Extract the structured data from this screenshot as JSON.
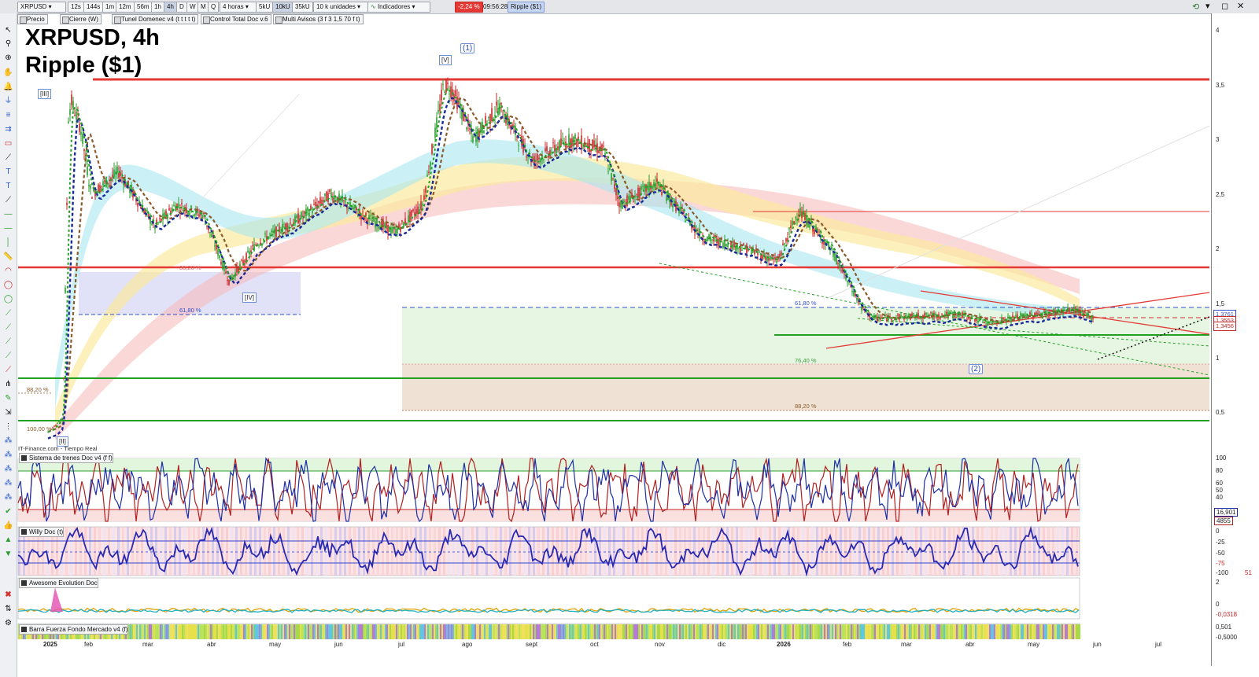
{
  "toolbar": {
    "symbol": "XRPUSD",
    "periods": [
      "12s",
      "144s",
      "1m",
      "12m",
      "56m",
      "1h",
      "4h",
      "D",
      "W",
      "M",
      "Q"
    ],
    "timeframe": "4 horas",
    "tick_modes": [
      "5kU",
      "10kU",
      "35kU"
    ],
    "units": "10 k unidades",
    "indicators": "Indicadores",
    "change": "-2,24 %",
    "time": "09:56:28",
    "name": "Ripple ($1)"
  },
  "indicator_bar": [
    "Precio",
    "Cierre (W)",
    "Tunel Domenec v4 (t t t t t)",
    "Control Total Doc v.6",
    "Multi Avisos (3 f 3 1,5 70 f t)"
  ],
  "chart": {
    "title_line1": "XRPUSD, 4h",
    "title_line2": "Ripple ($1)",
    "source": "IT-Finance.com - Tiempo Real",
    "wave_labels": [
      "[III]",
      "[II]",
      "[V]",
      "(1)",
      "[IV]",
      "(2)"
    ],
    "fib_labels": {
      "f1": "38,20 %",
      "f2": "61,80 %",
      "f3": "88,20 %",
      "f4": "100,00 %",
      "f5": "61,80 %",
      "f6": "76,40 %",
      "f7": "88,20 %"
    },
    "last_price": "1,3456",
    "price_tag_2": "1,3761",
    "price_tag_3": "1,3553",
    "colors": {
      "up": "#2e9d2e",
      "down": "#c62828",
      "red_line": "#e53935",
      "green_line": "#22a022",
      "blue_dash": "#3050d0"
    }
  },
  "axis": {
    "price_ticks": [
      "4",
      "3,5",
      "3",
      "2,5",
      "2",
      "1,5",
      "1",
      "0,5"
    ],
    "time_ticks": [
      "2025",
      "feb",
      "mar",
      "abr",
      "may",
      "jun",
      "jul",
      "ago",
      "sept",
      "oct",
      "nov",
      "dic",
      "2026",
      "feb",
      "mar",
      "abr",
      "may",
      "jun",
      "jul"
    ]
  },
  "panels": {
    "p1": {
      "title": "Sistema de trenes Doc v4 (f f)",
      "ticks": [
        "100",
        "80",
        "60",
        "50",
        "40"
      ],
      "v1": "16,901",
      "v2": "4855"
    },
    "p2": {
      "title": "Willy Doc (t)",
      "ticks": [
        "0",
        "-25",
        "-50",
        "-75",
        "-100"
      ],
      "v1": "51"
    },
    "p3": {
      "title": "Awesome Evolution Doc",
      "ticks": [
        "2",
        "0",
        "-0,0318"
      ]
    },
    "p4": {
      "title": "Barra Fuerza Fondo Mercado v4 (f)",
      "ticks": [
        "0,501",
        "-0,5000"
      ]
    }
  },
  "chart_data": {
    "type": "candlestick",
    "title": "XRPUSD, 4h",
    "price_axis": [
      0.5,
      4.0
    ],
    "x_labels": [
      "2025",
      "feb",
      "mar",
      "abr",
      "may",
      "jun",
      "jul",
      "ago",
      "sept",
      "oct",
      "nov",
      "dic",
      "2026",
      "feb",
      "mar",
      "abr",
      "may",
      "jun",
      "jul"
    ],
    "path": [
      [
        "2025-01-01",
        0.32
      ],
      [
        "2025-01-12",
        0.45
      ],
      [
        "2025-01-16",
        3.2
      ],
      [
        "2025-01-18",
        3.35
      ],
      [
        "2025-01-25",
        3.1
      ],
      [
        "2025-02-02",
        2.5
      ],
      [
        "2025-02-15",
        2.7
      ],
      [
        "2025-03-02",
        2.2
      ],
      [
        "2025-03-12",
        2.4
      ],
      [
        "2025-03-25",
        2.3
      ],
      [
        "2025-04-07",
        1.7
      ],
      [
        "2025-04-20",
        2.05
      ],
      [
        "2025-05-12",
        2.3
      ],
      [
        "2025-05-25",
        2.5
      ],
      [
        "2025-06-10",
        2.3
      ],
      [
        "2025-06-25",
        2.15
      ],
      [
        "2025-07-08",
        2.4
      ],
      [
        "2025-07-18",
        3.5
      ],
      [
        "2025-07-22",
        3.45
      ],
      [
        "2025-08-02",
        3.0
      ],
      [
        "2025-08-14",
        3.3
      ],
      [
        "2025-08-30",
        2.8
      ],
      [
        "2025-09-18",
        3.0
      ],
      [
        "2025-10-03",
        2.9
      ],
      [
        "2025-10-11",
        2.4
      ],
      [
        "2025-10-28",
        2.6
      ],
      [
        "2025-11-20",
        2.1
      ],
      [
        "2025-12-10",
        2.0
      ],
      [
        "2025-12-25",
        1.88
      ],
      [
        "2026-01-05",
        2.35
      ],
      [
        "2026-01-20",
        2.0
      ],
      [
        "2026-02-05",
        1.45
      ],
      [
        "2026-02-10",
        1.36
      ],
      [
        "2026-03-01",
        1.38
      ],
      [
        "2026-03-20",
        1.4
      ],
      [
        "2026-04-05",
        1.32
      ],
      [
        "2026-04-20",
        1.38
      ],
      [
        "2026-05-05",
        1.42
      ],
      [
        "2026-05-15",
        1.44
      ],
      [
        "2026-05-24",
        1.3456
      ]
    ],
    "horizontal_levels": [
      {
        "price": 3.55,
        "color": "red"
      },
      {
        "price": 1.85,
        "color": "red"
      },
      {
        "price": 1.2,
        "color": "green"
      },
      {
        "price": 0.82,
        "color": "green"
      },
      {
        "price": 0.42,
        "color": "green"
      },
      {
        "price": 2.35,
        "color": "red"
      },
      {
        "price": 1.47,
        "color": "blue-dash"
      },
      {
        "price": 1.37,
        "color": "red-dash"
      }
    ]
  }
}
